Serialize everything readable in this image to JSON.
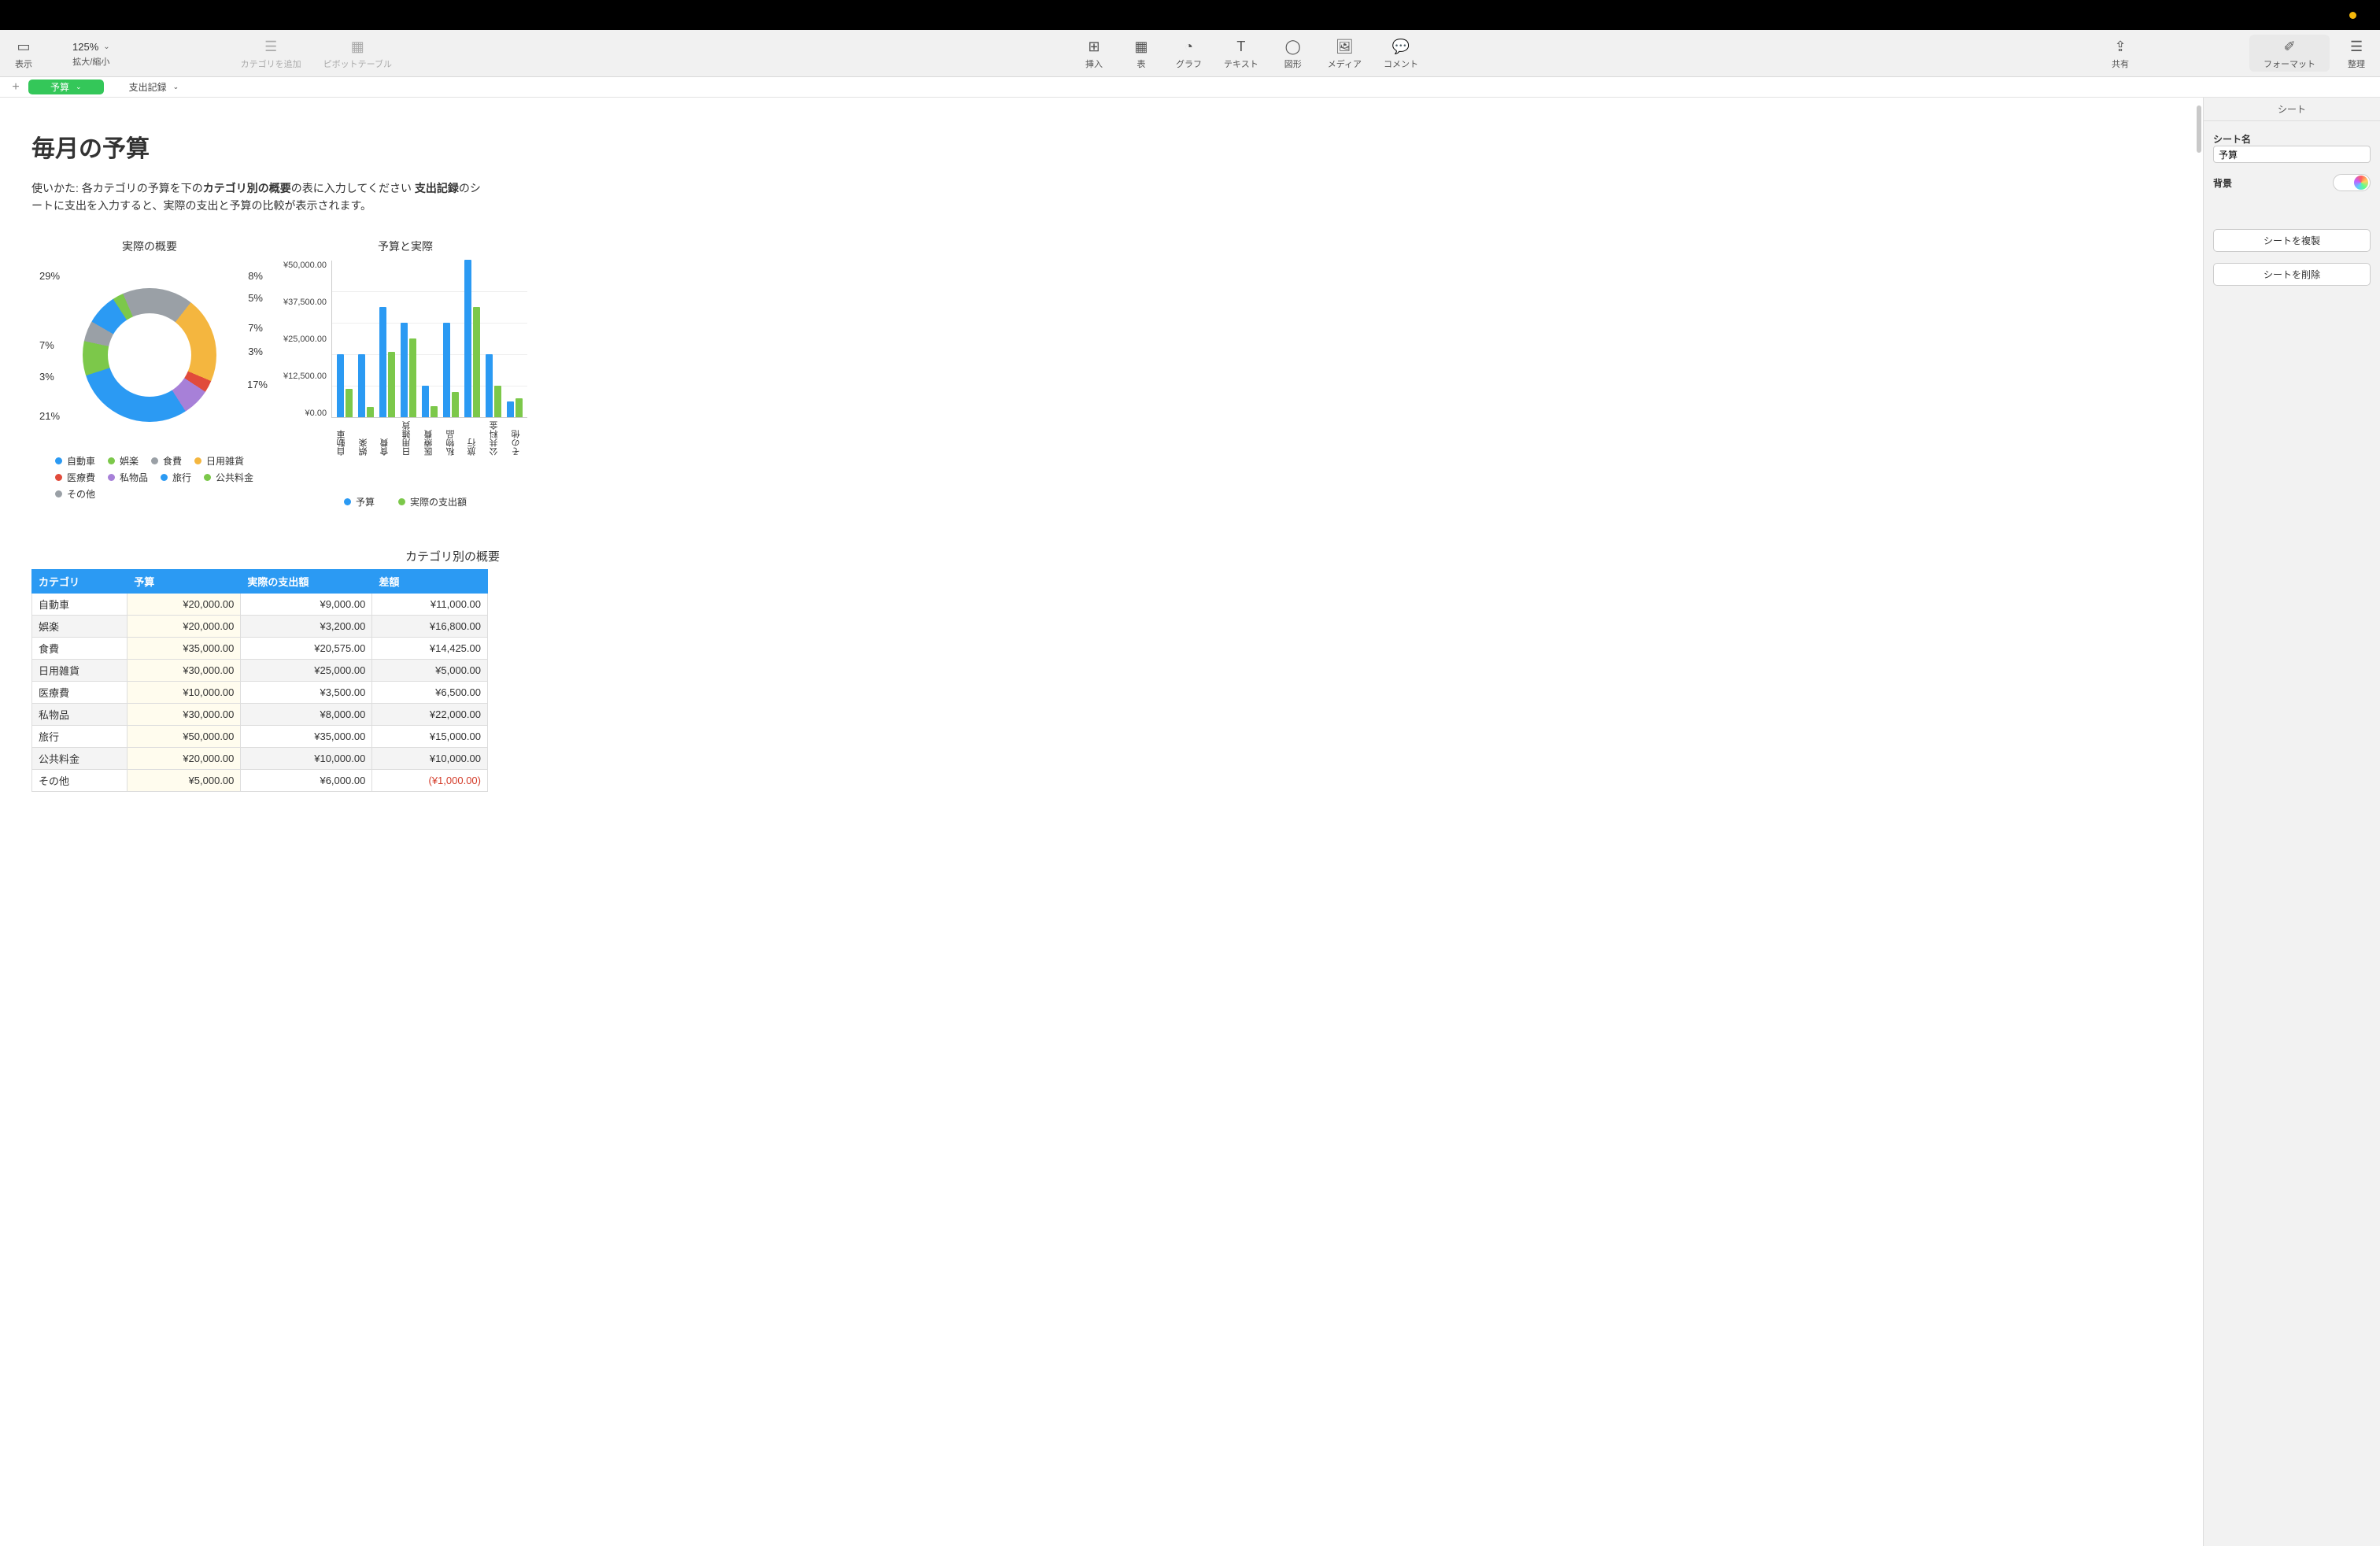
{
  "toolbar": {
    "view": "表示",
    "zoom_value": "125%",
    "zoom_label": "拡大/縮小",
    "add_category": "カテゴリを追加",
    "pivot": "ピボットテーブル",
    "insert": "挿入",
    "table": "表",
    "chart": "グラフ",
    "text": "テキスト",
    "shape": "図形",
    "media": "メディア",
    "comment": "コメント",
    "share": "共有",
    "format": "フォーマット",
    "organize": "整理"
  },
  "tabs": {
    "add": "+",
    "items": [
      {
        "label": "予算",
        "active": true
      },
      {
        "label": "支出記録",
        "active": false
      }
    ]
  },
  "document": {
    "title": "毎月の予算",
    "instructions_pre": "使いかた: 各カテゴリの予算を下の",
    "instructions_b1": "カテゴリ別の概要",
    "instructions_mid": "の表に入力してください ",
    "instructions_b2": "支出記録",
    "instructions_post": "のシートに支出を入力すると、実際の支出と予算の比較が表示されます。"
  },
  "chart_data": [
    {
      "type": "pie",
      "title": "実際の概要",
      "series": [
        {
          "name": "自動車",
          "value": 9000,
          "pct": "8%",
          "color": "#2b9af3"
        },
        {
          "name": "娯楽",
          "value": 3200,
          "pct": "5%",
          "color": "#7cc84a"
        },
        {
          "name": "食費",
          "value": 20575,
          "pct": "7%",
          "color": "#9aa0a6"
        },
        {
          "name": "日用雑貨",
          "value": 25000,
          "pct": "3%",
          "color": "#f4b63f"
        },
        {
          "name": "医療費",
          "value": 3500,
          "pct": "17%",
          "color": "#e14b3b"
        },
        {
          "name": "私物品",
          "value": 8000,
          "pct": "21%",
          "color": "#a780d8"
        },
        {
          "name": "旅行",
          "value": 35000,
          "pct": "3%",
          "color": "#2b9af3"
        },
        {
          "name": "公共料金",
          "value": 10000,
          "pct": "7%",
          "color": "#7cc84a"
        },
        {
          "name": "その他",
          "value": 6000,
          "pct": "29%",
          "color": "#9aa0a6"
        }
      ],
      "legend": [
        "自動車",
        "娯楽",
        "食費",
        "日用雑貨",
        "医療費",
        "私物品",
        "旅行",
        "公共料金",
        "その他"
      ],
      "legend_colors": [
        "#2b9af3",
        "#7cc84a",
        "#9aa0a6",
        "#f4b63f",
        "#e14b3b",
        "#a780d8",
        "#2b9af3",
        "#7cc84a",
        "#9aa0a6"
      ]
    },
    {
      "type": "bar",
      "title": "予算と実際",
      "ylabel": "",
      "ylim": [
        0,
        50000
      ],
      "yticks": [
        "¥50,000.00",
        "¥37,500.00",
        "¥25,000.00",
        "¥12,500.00",
        "¥0.00"
      ],
      "categories": [
        "自動車",
        "娯楽",
        "食費",
        "日用雑貨",
        "医療費",
        "私物品",
        "旅行",
        "公共料金",
        "その他"
      ],
      "series": [
        {
          "name": "予算",
          "color": "#2b9af3",
          "values": [
            20000,
            20000,
            35000,
            30000,
            10000,
            30000,
            50000,
            20000,
            5000
          ]
        },
        {
          "name": "実際の支出額",
          "color": "#7cc84a",
          "values": [
            9000,
            3200,
            20575,
            25000,
            3500,
            8000,
            35000,
            10000,
            6000
          ]
        }
      ]
    }
  ],
  "table": {
    "title": "カテゴリ別の概要",
    "headers": [
      "カテゴリ",
      "予算",
      "実際の支出額",
      "差額"
    ],
    "rows": [
      {
        "cat": "自動車",
        "budget": "¥20,000.00",
        "actual": "¥9,000.00",
        "diff": "¥11,000.00",
        "neg": false
      },
      {
        "cat": "娯楽",
        "budget": "¥20,000.00",
        "actual": "¥3,200.00",
        "diff": "¥16,800.00",
        "neg": false
      },
      {
        "cat": "食費",
        "budget": "¥35,000.00",
        "actual": "¥20,575.00",
        "diff": "¥14,425.00",
        "neg": false
      },
      {
        "cat": "日用雑貨",
        "budget": "¥30,000.00",
        "actual": "¥25,000.00",
        "diff": "¥5,000.00",
        "neg": false
      },
      {
        "cat": "医療費",
        "budget": "¥10,000.00",
        "actual": "¥3,500.00",
        "diff": "¥6,500.00",
        "neg": false
      },
      {
        "cat": "私物品",
        "budget": "¥30,000.00",
        "actual": "¥8,000.00",
        "diff": "¥22,000.00",
        "neg": false
      },
      {
        "cat": "旅行",
        "budget": "¥50,000.00",
        "actual": "¥35,000.00",
        "diff": "¥15,000.00",
        "neg": false
      },
      {
        "cat": "公共料金",
        "budget": "¥20,000.00",
        "actual": "¥10,000.00",
        "diff": "¥10,000.00",
        "neg": false
      },
      {
        "cat": "その他",
        "budget": "¥5,000.00",
        "actual": "¥6,000.00",
        "diff": "(¥1,000.00)",
        "neg": true
      }
    ]
  },
  "inspector": {
    "tab": "シート",
    "name_label": "シート名",
    "name_value": "予算",
    "background_label": "背景",
    "duplicate": "シートを複製",
    "delete": "シートを削除"
  }
}
